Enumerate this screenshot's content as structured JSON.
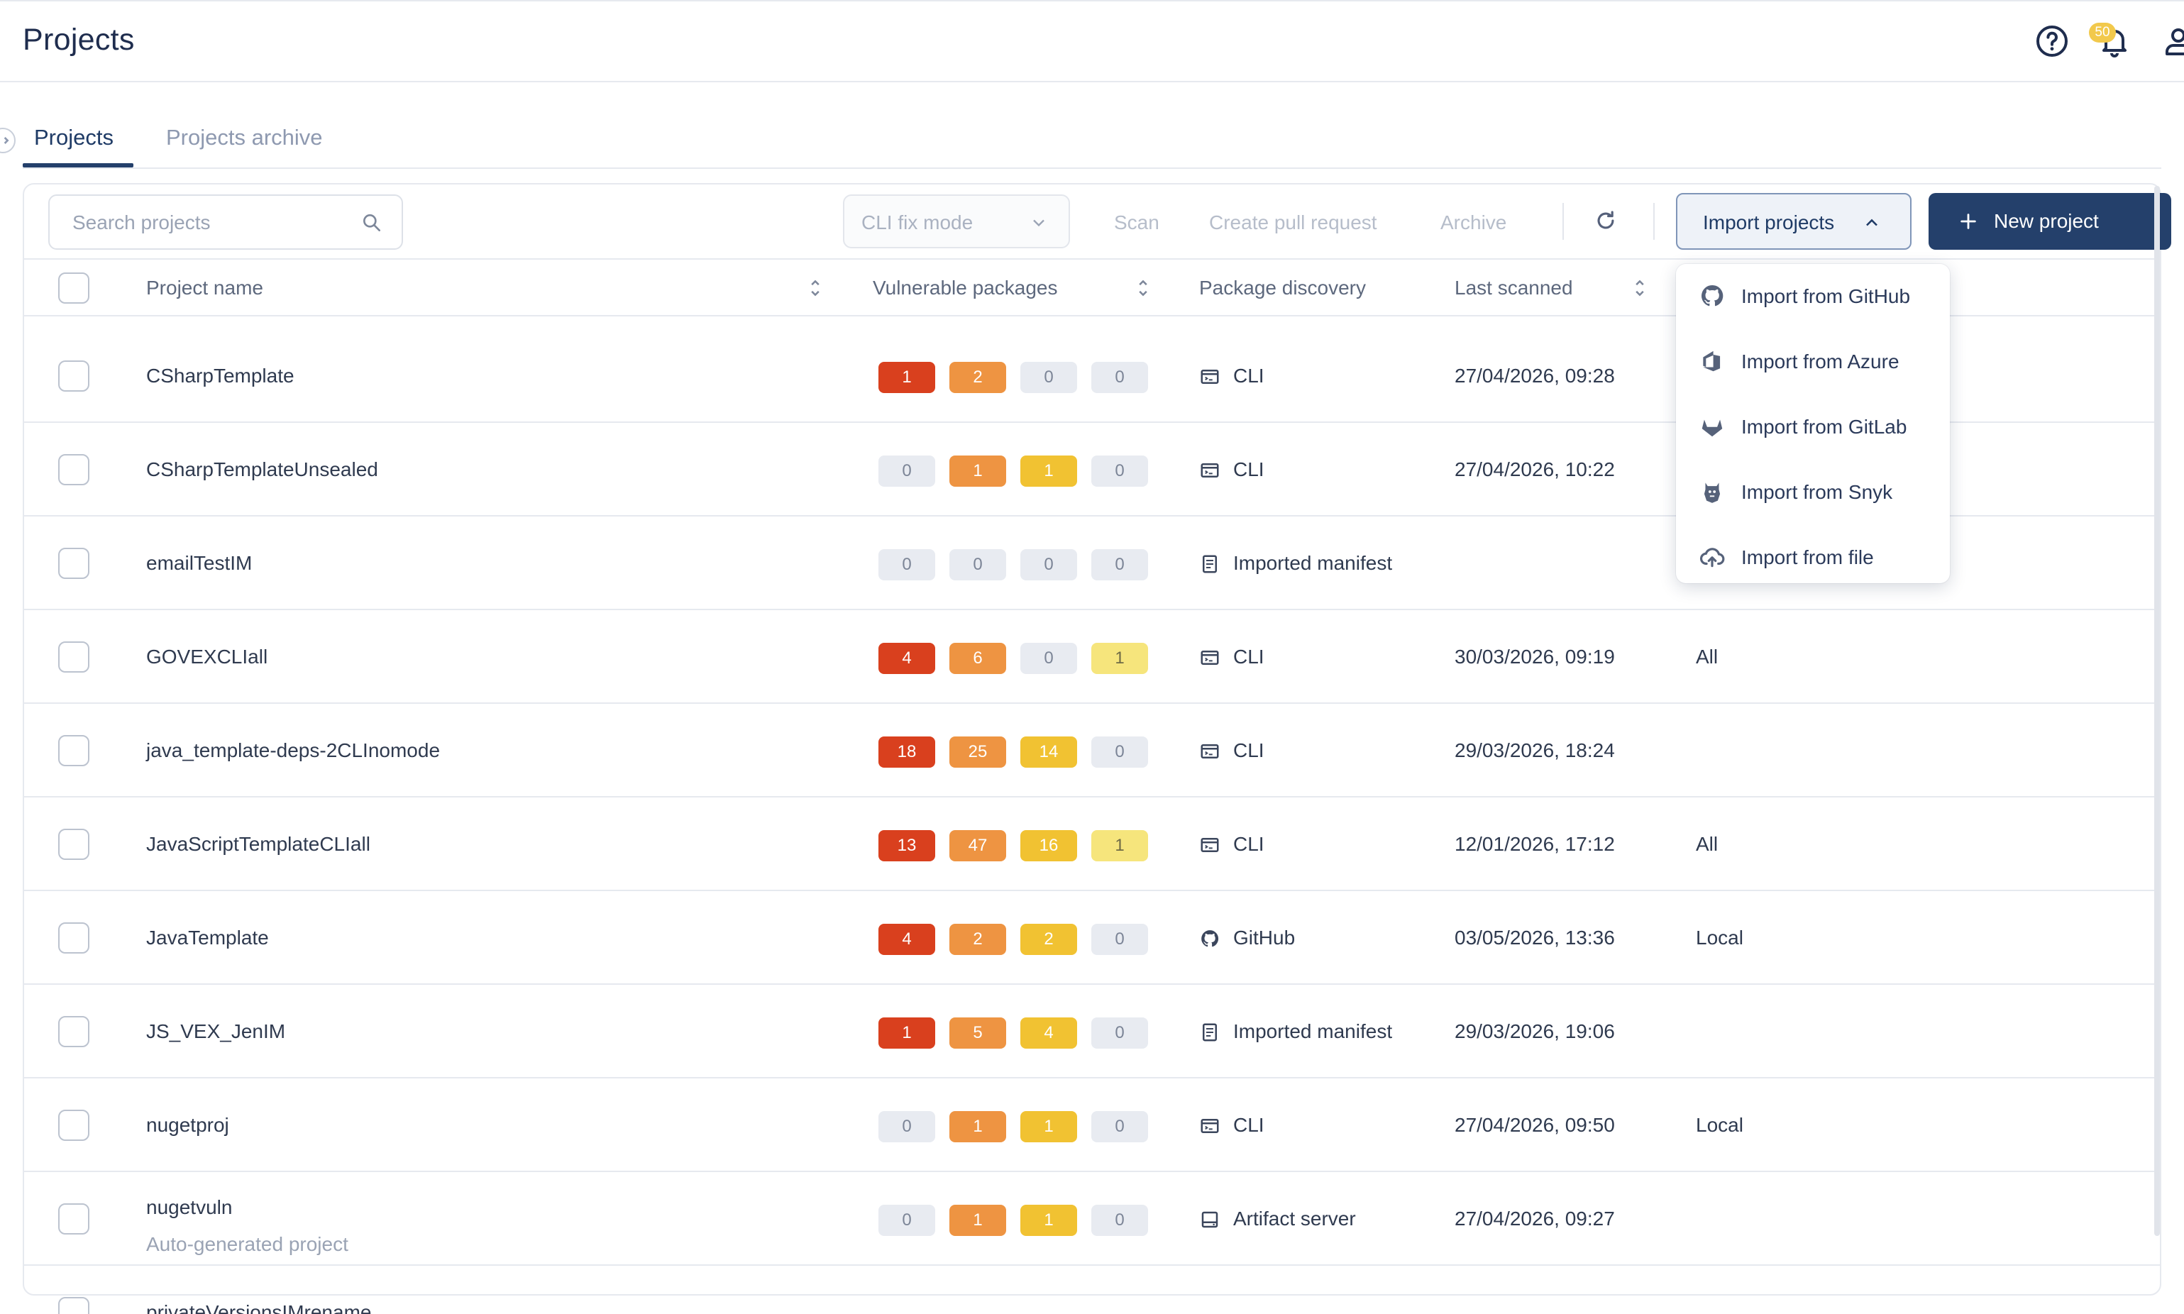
{
  "header": {
    "title": "Projects",
    "notification_count": "50"
  },
  "tabs": [
    {
      "label": "Projects",
      "active": true
    },
    {
      "label": "Projects archive",
      "active": false
    }
  ],
  "toolbar": {
    "search_placeholder": "Search projects",
    "fix_mode_value": "CLI fix mode",
    "scan_label": "Scan",
    "create_pr_label": "Create pull request",
    "archive_label": "Archive",
    "import_label": "Import projects",
    "new_project_label": "New project"
  },
  "table": {
    "columns": {
      "name": "Project name",
      "vulnerable": "Vulnerable packages",
      "discovery": "Package discovery",
      "last_scanned": "Last scanned"
    },
    "rows": [
      {
        "name": "CSharpTemplate",
        "sub": "",
        "counts": [
          "1",
          "2",
          "0",
          "0"
        ],
        "discovery": "CLI",
        "discovery_icon": "terminal-icon",
        "scanned": "27/04/2026, 09:28",
        "extra": ""
      },
      {
        "name": "CSharpTemplateUnsealed",
        "sub": "",
        "counts": [
          "0",
          "1",
          "1",
          "0"
        ],
        "discovery": "CLI",
        "discovery_icon": "terminal-icon",
        "scanned": "27/04/2026, 10:22",
        "extra": ""
      },
      {
        "name": "emailTestIM",
        "sub": "",
        "counts": [
          "0",
          "0",
          "0",
          "0"
        ],
        "discovery": "Imported manifest",
        "discovery_icon": "document-icon",
        "scanned": "",
        "extra": ""
      },
      {
        "name": "GOVEXCLIall",
        "sub": "",
        "counts": [
          "4",
          "6",
          "0",
          "1"
        ],
        "discovery": "CLI",
        "discovery_icon": "terminal-icon",
        "scanned": "30/03/2026, 09:19",
        "extra": "All"
      },
      {
        "name": "java_template-deps-2CLInomode",
        "sub": "",
        "counts": [
          "18",
          "25",
          "14",
          "0"
        ],
        "discovery": "CLI",
        "discovery_icon": "terminal-icon",
        "scanned": "29/03/2026, 18:24",
        "extra": ""
      },
      {
        "name": "JavaScriptTemplateCLIall",
        "sub": "",
        "counts": [
          "13",
          "47",
          "16",
          "1"
        ],
        "discovery": "CLI",
        "discovery_icon": "terminal-icon",
        "scanned": "12/01/2026, 17:12",
        "extra": "All"
      },
      {
        "name": "JavaTemplate",
        "sub": "",
        "counts": [
          "4",
          "2",
          "2",
          "0"
        ],
        "discovery": "GitHub",
        "discovery_icon": "github-icon",
        "scanned": "03/05/2026, 13:36",
        "extra": "Local"
      },
      {
        "name": "JS_VEX_JenIM",
        "sub": "",
        "counts": [
          "1",
          "5",
          "4",
          "0"
        ],
        "discovery": "Imported manifest",
        "discovery_icon": "document-icon",
        "scanned": "29/03/2026, 19:06",
        "extra": ""
      },
      {
        "name": "nugetproj",
        "sub": "",
        "counts": [
          "0",
          "1",
          "1",
          "0"
        ],
        "discovery": "CLI",
        "discovery_icon": "terminal-icon",
        "scanned": "27/04/2026, 09:50",
        "extra": "Local"
      },
      {
        "name": "nugetvuln",
        "sub": "Auto-generated project",
        "counts": [
          "0",
          "1",
          "1",
          "0"
        ],
        "discovery": "Artifact server",
        "discovery_icon": "server-icon",
        "scanned": "27/04/2026, 09:27",
        "extra": ""
      },
      {
        "name": "privateVersionsIMrename",
        "sub": "",
        "counts": [
          "",
          "",
          "",
          ""
        ],
        "discovery": "",
        "discovery_icon": "",
        "scanned": "",
        "extra": ""
      }
    ]
  },
  "import_menu": [
    {
      "label": "Import from GitHub",
      "icon": "github-icon"
    },
    {
      "label": "Import from Azure",
      "icon": "azure-icon"
    },
    {
      "label": "Import from GitLab",
      "icon": "gitlab-icon"
    },
    {
      "label": "Import from Snyk",
      "icon": "snyk-icon"
    },
    {
      "label": "Import from file",
      "icon": "cloud-upload-icon"
    }
  ],
  "colors": {
    "critical": "#d9401e",
    "high": "#ee9442",
    "medium": "#f1c232",
    "low": "#f6e57c",
    "zero": "#e8ebf1",
    "primary": "#24406b"
  }
}
